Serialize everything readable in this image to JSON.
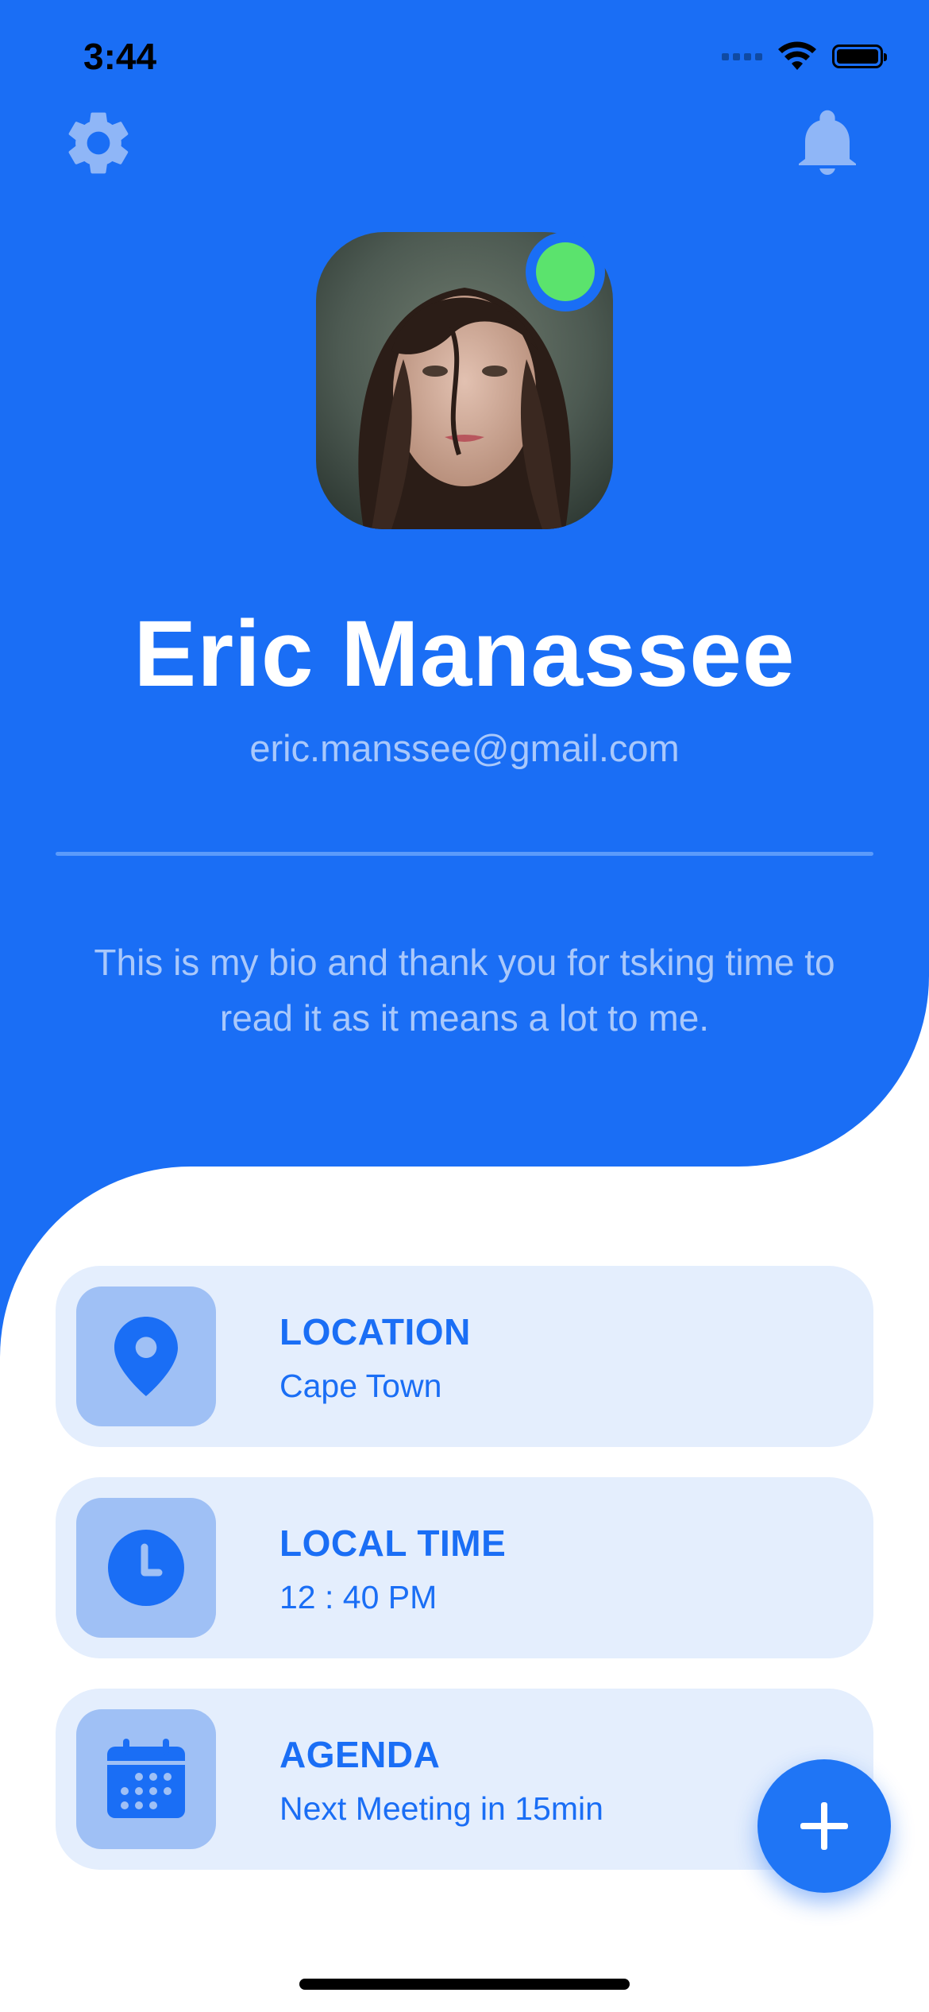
{
  "status_bar": {
    "time": "3:44"
  },
  "profile": {
    "name": "Eric Manassee",
    "email": "eric.manssee@gmail.com",
    "bio": "This is my bio and thank you for tsking time to read it as it means a lot to me.",
    "online": true
  },
  "cards": [
    {
      "label": "LOCATION",
      "value": "Cape Town",
      "icon": "location-pin-icon"
    },
    {
      "label": "LOCAL TIME",
      "value": "12 : 40 PM",
      "icon": "clock-icon"
    },
    {
      "label": "AGENDA",
      "value": "Next Meeting in 15min",
      "icon": "calendar-icon"
    }
  ],
  "colors": {
    "primary": "#1a6ef5",
    "card_bg": "#e4eefd",
    "icon_box": "#9fc0f5",
    "online": "#5be36d",
    "muted_text": "#a9c8fb"
  },
  "icons": {
    "settings": "gear-icon",
    "notifications": "bell-icon",
    "fab": "plus-icon"
  }
}
